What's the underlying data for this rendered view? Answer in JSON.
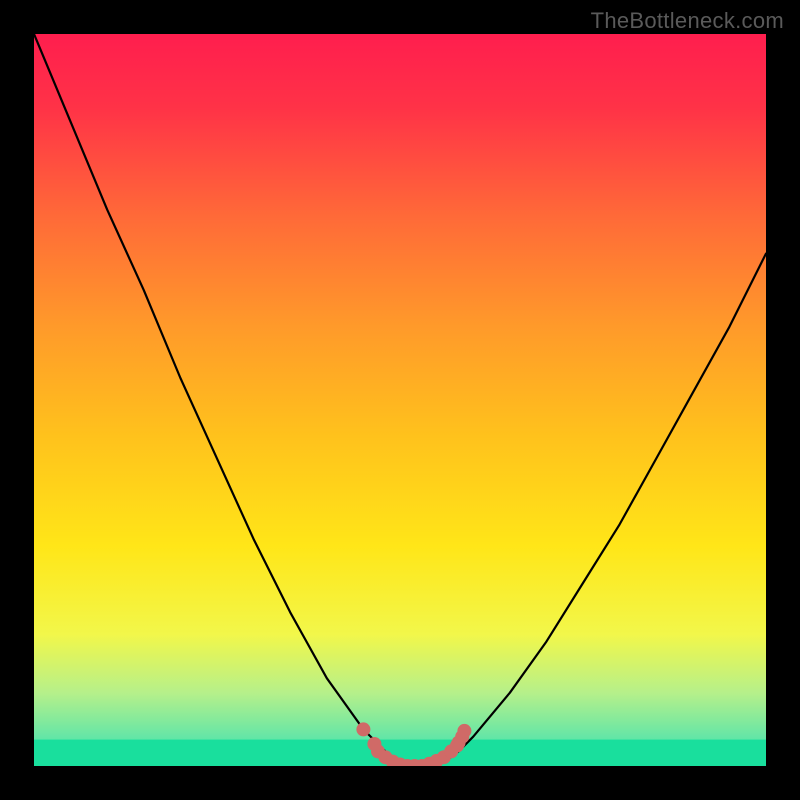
{
  "watermark": {
    "text": "TheBottleneck.com"
  },
  "gradient": {
    "stops": [
      {
        "offset": 0.0,
        "color": "#ff1e4e"
      },
      {
        "offset": 0.1,
        "color": "#ff3247"
      },
      {
        "offset": 0.25,
        "color": "#ff6a38"
      },
      {
        "offset": 0.4,
        "color": "#ff9a2a"
      },
      {
        "offset": 0.55,
        "color": "#ffc21c"
      },
      {
        "offset": 0.7,
        "color": "#ffe618"
      },
      {
        "offset": 0.82,
        "color": "#f2f74a"
      },
      {
        "offset": 0.9,
        "color": "#b6f08a"
      },
      {
        "offset": 0.96,
        "color": "#66e6a6"
      },
      {
        "offset": 1.0,
        "color": "#19df9d"
      }
    ]
  },
  "greenBase": {
    "y": 0.964,
    "color": "#19df9d"
  },
  "chart_data": {
    "type": "line",
    "title": "",
    "xlabel": "",
    "ylabel": "",
    "xlim": [
      0,
      100
    ],
    "ylim": [
      0,
      100
    ],
    "series": [
      {
        "name": "bottleneck-curve",
        "x": [
          0,
          5,
          10,
          15,
          20,
          25,
          30,
          35,
          40,
          45,
          48,
          50,
          53,
          56,
          58,
          60,
          65,
          70,
          75,
          80,
          85,
          90,
          95,
          100
        ],
        "y": [
          100,
          88,
          76,
          65,
          53,
          42,
          31,
          21,
          12,
          5,
          2,
          0.5,
          0,
          0.5,
          2,
          4,
          10,
          17,
          25,
          33,
          42,
          51,
          60,
          70
        ]
      }
    ],
    "markers": {
      "name": "bottom-dots",
      "color": "#d06a67",
      "points": [
        {
          "x": 45,
          "y": 5
        },
        {
          "x": 46.5,
          "y": 3
        },
        {
          "x": 47,
          "y": 2
        },
        {
          "x": 48,
          "y": 1.2
        },
        {
          "x": 49,
          "y": 0.6
        },
        {
          "x": 50,
          "y": 0.2
        },
        {
          "x": 51,
          "y": 0.0
        },
        {
          "x": 52,
          "y": 0.0
        },
        {
          "x": 53,
          "y": 0.0
        },
        {
          "x": 54,
          "y": 0.3
        },
        {
          "x": 55,
          "y": 0.7
        },
        {
          "x": 56,
          "y": 1.2
        },
        {
          "x": 57,
          "y": 2.0
        },
        {
          "x": 57.8,
          "y": 2.8
        },
        {
          "x": 58,
          "y": 3.2
        },
        {
          "x": 58.5,
          "y": 4.0
        },
        {
          "x": 58.8,
          "y": 4.8
        }
      ]
    }
  }
}
